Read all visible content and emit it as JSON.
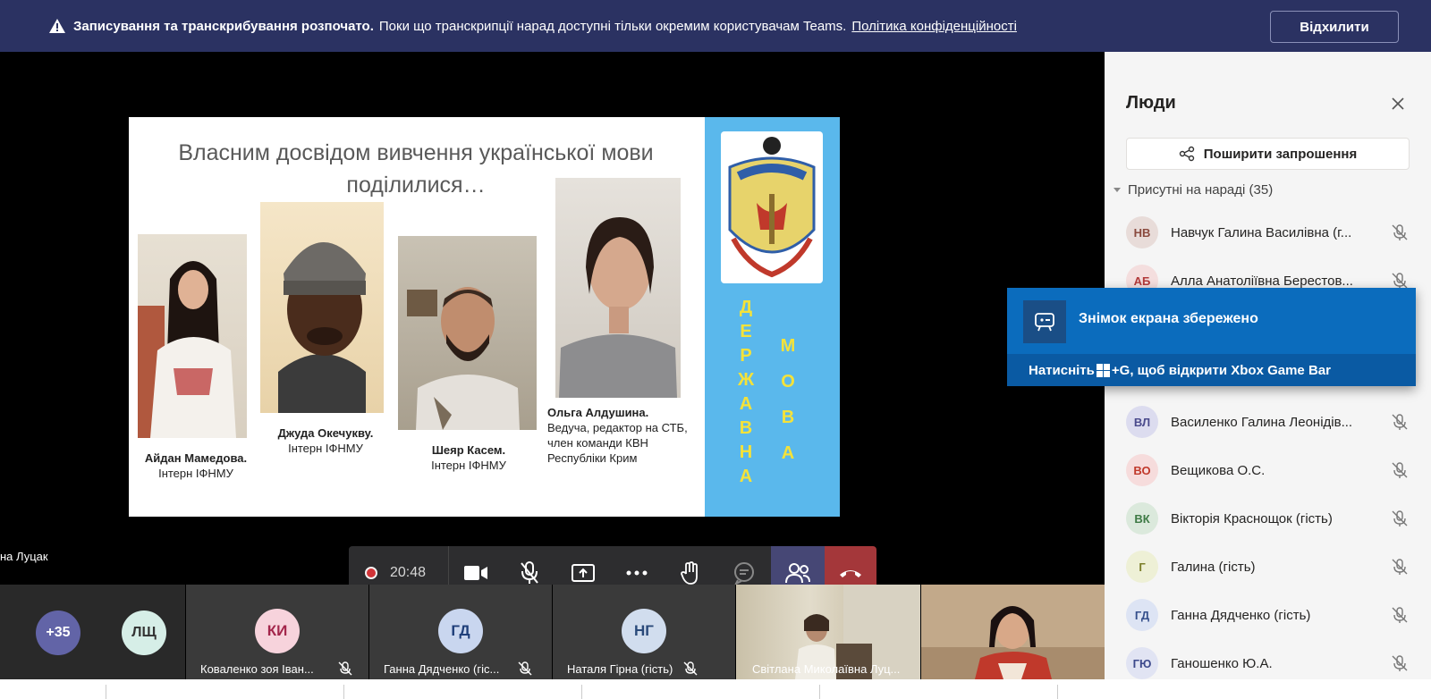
{
  "banner": {
    "title": "Записування та транскрибування розпочато.",
    "message": "Поки що транскрипції нарад доступні тільки окремим користувачам Teams.",
    "link": "Політика конфіденційності",
    "dismiss_label": "Відхилити",
    "icon": "warning-icon"
  },
  "slide": {
    "title_line1": "Власним досвідом вивчення української мови",
    "title_line2": "поділилися…",
    "people": [
      {
        "name": "Айдан Мамедова.",
        "role": "Інтерн ІФНМУ"
      },
      {
        "name": "Джуда Окечукву.",
        "role": "Інтерн ІФНМУ"
      },
      {
        "name": "Шеяр Касем",
        "role": "Інтерн ІФНМУ"
      },
      {
        "name": "Ольга Алдушина.",
        "role_line1": "Ведуча, редактор на СТБ,",
        "role_line2": "член команди КВН",
        "role_line3": "Республіки Крим"
      }
    ],
    "vertical_word1": [
      "Д",
      "Е",
      "Р",
      "Ж",
      "А",
      "В",
      "Н",
      "А"
    ],
    "vertical_word2": [
      "М",
      "О",
      "В",
      "А"
    ]
  },
  "speaker_name": "на Луцак",
  "controls": {
    "timer": "20:48",
    "icons": [
      "record-icon",
      "camera-icon",
      "mic-off-icon",
      "share-screen-icon",
      "more-icon",
      "raise-hand-icon",
      "chat-icon",
      "people-icon",
      "hangup-icon"
    ]
  },
  "strip": {
    "overflow_count": "+35",
    "tiles": [
      {
        "initials": "ЛЩ",
        "name": ""
      },
      {
        "initials": "КИ",
        "name": "Коваленко зоя Іван..."
      },
      {
        "initials": "ГД",
        "name": "Ганна Дядченко (гіс..."
      },
      {
        "initials": "НГ",
        "name": "Наталя Гірна (гість)"
      },
      {
        "initials": "",
        "name": "Світлана Миколаївна Луц..."
      },
      {
        "initials": "",
        "name": ""
      }
    ]
  },
  "panel": {
    "title": "Люди",
    "share_label": "Поширити запрошення",
    "section_label": "Присутні на нараді (35)",
    "people": [
      {
        "initials": "НВ",
        "name": "Навчук Галина Василівна (г...",
        "bg": "#e8dcd9",
        "fg": "#8a4a3e"
      },
      {
        "initials": "АБ",
        "name": "Алла Анатоліївна Берестов...",
        "bg": "#f4dede",
        "fg": "#b23a3a"
      },
      {
        "initials": "",
        "name": "",
        "bg": "#e3e3e3",
        "fg": "#555"
      },
      {
        "initials": "ВЛ",
        "name": "Василенко Галина Леонідів...",
        "bg": "#dcdcef",
        "fg": "#4a4a8c"
      },
      {
        "initials": "ВО",
        "name": "Вещикова О.С.",
        "bg": "#f6dcdc",
        "fg": "#c0392b"
      },
      {
        "initials": "ВК",
        "name": "Вікторія Краснощок (гість)",
        "bg": "#dbe9dc",
        "fg": "#3e7a45"
      },
      {
        "initials": "Г",
        "name": "Галина (гість)",
        "bg": "#eef0d6",
        "fg": "#7c7f2a"
      },
      {
        "initials": "ГД",
        "name": "Ганна Дядченко (гість)",
        "bg": "#dde4f4",
        "fg": "#36508c"
      },
      {
        "initials": "ГЮ",
        "name": "Ганошенко Ю.А.",
        "bg": "#e1e4f3",
        "fg": "#3d4a8c"
      }
    ]
  },
  "toast": {
    "title": "Знімок екрана збережено",
    "hint_prefix": "Натисніть",
    "hint_suffix": "+G, щоб відкрити Xbox Game Bar"
  },
  "colors": {
    "banner_bg": "#2b3262",
    "teams_purple": "#464775",
    "hangup_red": "#a4373a",
    "toast_blue": "#0b6cbd",
    "slide_side": "#5ab8ec"
  }
}
